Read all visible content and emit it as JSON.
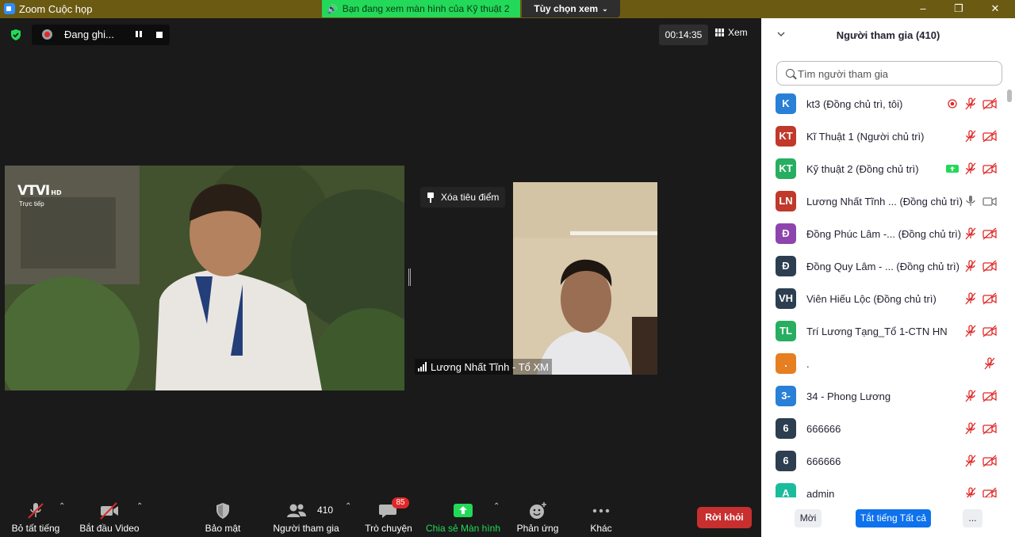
{
  "window": {
    "title": "Zoom Cuộc họp",
    "share_banner": "Bạn đang xem màn hình của Kỹ thuật 2",
    "view_options": "Tùy chọn xem"
  },
  "meeting": {
    "recording_label": "Đang ghi...",
    "timer": "00:14:35",
    "view_label": "Xem",
    "unpin_label": "Xóa tiêu điểm",
    "speaker_name": "Lương Nhất Tĩnh - Tổ XM",
    "video_logo": "VTVI",
    "video_logo_suffix": "HD",
    "video_live": "Trực tiếp"
  },
  "toolbar": {
    "mute_all": "Bỏ tất tiếng",
    "start_video": "Bắt đầu Video",
    "security": "Bảo mật",
    "participants": "Người tham gia",
    "participants_count": "410",
    "chat": "Trò chuyện",
    "chat_badge": "85",
    "share_screen": "Chia sẻ Màn hình",
    "reactions": "Phản ứng",
    "more": "Khác",
    "leave": "Rời khỏi",
    "share_color": "#23d959",
    "leave_color": "#c82f2f"
  },
  "panel": {
    "title": "Người tham gia (410)",
    "search_placeholder": "Tìm người tham gia",
    "participants": [
      {
        "initials": "K",
        "name": "kt3 (Đồng chủ trì, tôi)",
        "color": "#2a7fd6",
        "status": "recording"
      },
      {
        "initials": "KT",
        "name": "Kĩ Thuật 1 (Người chủ trì)",
        "color": "#c0392b",
        "status": "none"
      },
      {
        "initials": "KT",
        "name": "Kỹ thuật 2 (Đồng chủ trì)",
        "color": "#27ae60",
        "status": "sharing"
      },
      {
        "initials": "LN",
        "name": "Lương Nhất Tĩnh ...  (Đồng chủ trì)",
        "color": "#c0392b",
        "status": "live"
      },
      {
        "initials": "Đ",
        "name": "Đồng Phúc Lâm -...  (Đồng chủ trì)",
        "color": "#8e44ad",
        "status": "none"
      },
      {
        "initials": "Đ",
        "name": "Đồng Quy Lâm - ...  (Đồng chủ trì)",
        "color": "#2c3e50",
        "status": "none"
      },
      {
        "initials": "VH",
        "name": "Viên Hiếu Lộc (Đồng chủ trì)",
        "color": "#2c3e50",
        "status": "none"
      },
      {
        "initials": "TL",
        "name": " Trí Lương Tạng_Tổ 1-CTN HN",
        "color": "#27ae60",
        "status": "none"
      },
      {
        "initials": ".",
        "name": ".",
        "color": "#e67e22",
        "status": "audio-only"
      },
      {
        "initials": "3-",
        "name": "34 - Phong Lương",
        "color": "#2a7fd6",
        "status": "none"
      },
      {
        "initials": "6",
        "name": "666666",
        "color": "#2c3e50",
        "status": "none"
      },
      {
        "initials": "6",
        "name": "666666",
        "color": "#2c3e50",
        "status": "none"
      },
      {
        "initials": "A",
        "name": "admin",
        "color": "#1abc9c",
        "status": "none"
      }
    ],
    "invite": "Mời",
    "mute_all": "Tắt tiếng Tất cả",
    "more": "..."
  }
}
